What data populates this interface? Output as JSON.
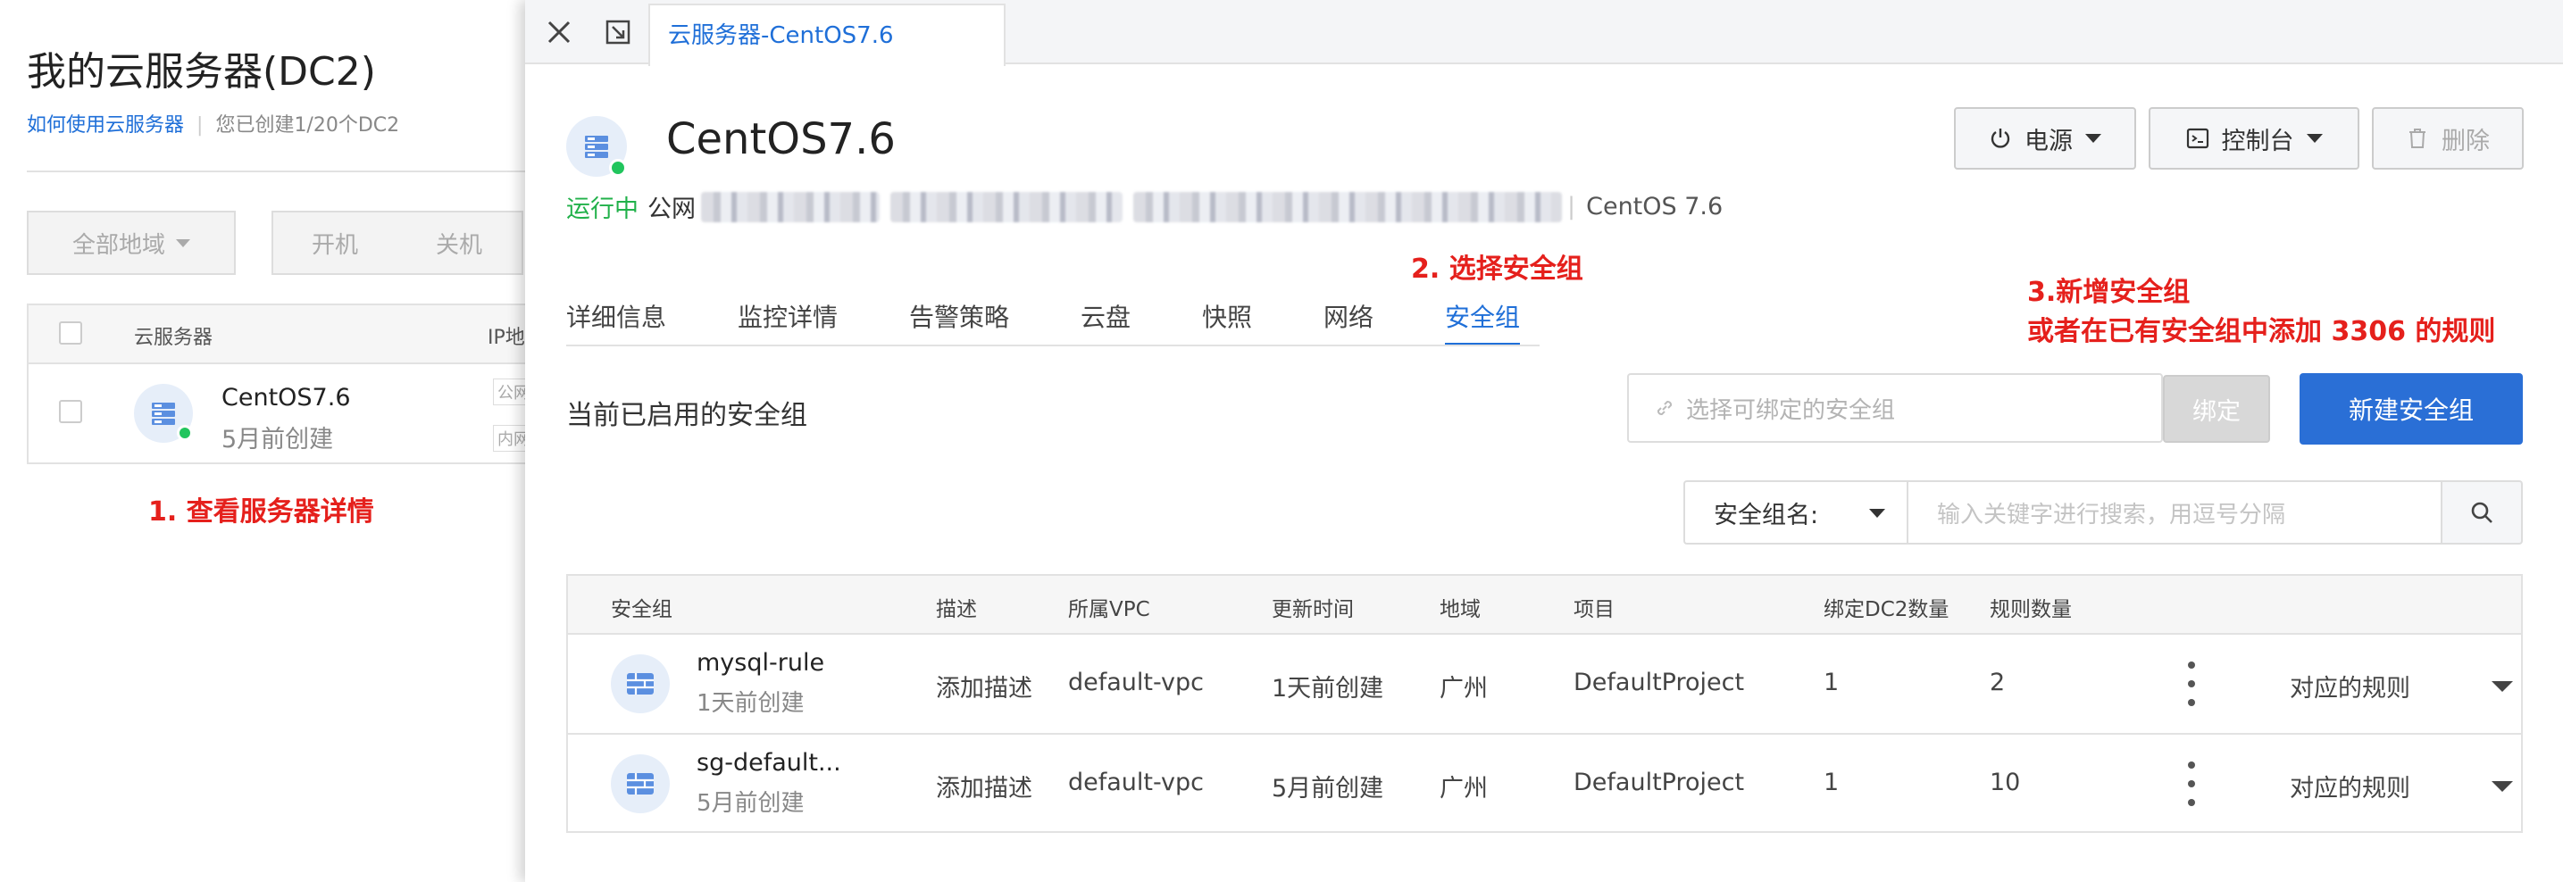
{
  "background_page": {
    "title": "我的云服务器(DC2)",
    "help_link": "如何使用云服务器",
    "quota_text": "您已创建1/20个DC2",
    "region_button": "全部地域",
    "power_on_button": "开机",
    "power_off_button": "关机",
    "table": {
      "col_server": "云服务器",
      "col_ip": "IP地",
      "row": {
        "name": "CentOS7.6",
        "created": "5月前创建",
        "tag_public": "公网",
        "tag_private": "内网"
      }
    }
  },
  "annotations": {
    "step1": "1. 查看服务器详情",
    "step2": "2. 选择安全组",
    "step3_line1": "3.新增安全组",
    "step3_line2": "或者在已有安全组中添加 3306 的规则"
  },
  "drawer": {
    "tab_title": "云服务器-CentOS7.6",
    "instance_name": "CentOS7.6",
    "status": "运行中",
    "ip_label": "公网",
    "os_label": "CentOS 7.6",
    "power_button": "电源",
    "console_button": "控制台",
    "delete_button": "删除",
    "tabs": [
      "详细信息",
      "监控详情",
      "告警策略",
      "云盘",
      "快照",
      "网络",
      "安全组"
    ],
    "active_tab": "安全组",
    "section_title": "当前已启用的安全组",
    "bind_placeholder": "选择可绑定的安全组",
    "bind_button": "绑定",
    "new_sg_button": "新建安全组",
    "filter_label": "安全组名:",
    "search_placeholder": "输入关键字进行搜索，用逗号分隔",
    "table": {
      "headers": [
        "安全组",
        "描述",
        "所属VPC",
        "更新时间",
        "地域",
        "项目",
        "绑定DC2数量",
        "规则数量"
      ],
      "rows": [
        {
          "name": "mysql-rule",
          "created": "1天前创建",
          "desc": "添加描述",
          "vpc": "default-vpc",
          "updated": "1天前创建",
          "region": "广州",
          "project": "DefaultProject",
          "dc2_count": "1",
          "rule_count": "2",
          "rules_link": "对应的规则"
        },
        {
          "name": "sg-default...",
          "created": "5月前创建",
          "desc": "添加描述",
          "vpc": "default-vpc",
          "updated": "5月前创建",
          "region": "广州",
          "project": "DefaultProject",
          "dc2_count": "1",
          "rule_count": "10",
          "rules_link": "对应的规则"
        }
      ]
    }
  },
  "colors": {
    "accent": "#1f6fd8",
    "primary_button": "#2a6fd6",
    "running": "#21b14a",
    "annotation": "#e5201c"
  }
}
